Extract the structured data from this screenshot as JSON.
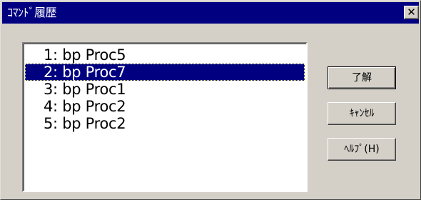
{
  "dialog": {
    "title": "ｺﾏﾝﾄﾞ履歴",
    "close_glyph": "✕"
  },
  "history": {
    "selected_index": 1,
    "items": [
      {
        "label": "1: bp Proc5"
      },
      {
        "label": "2: bp Proc7"
      },
      {
        "label": "3: bp Proc1"
      },
      {
        "label": "4: bp Proc2"
      },
      {
        "label": "5: bp Proc2"
      }
    ]
  },
  "buttons": {
    "ok_label": "了解",
    "cancel_label": "ｷｬﾝｾﾙ",
    "help_label": "ﾍﾙﾌﾟ(H)"
  },
  "colors": {
    "titlebar": "#000080",
    "face": "#d4d0c8",
    "selection": "#000080"
  }
}
